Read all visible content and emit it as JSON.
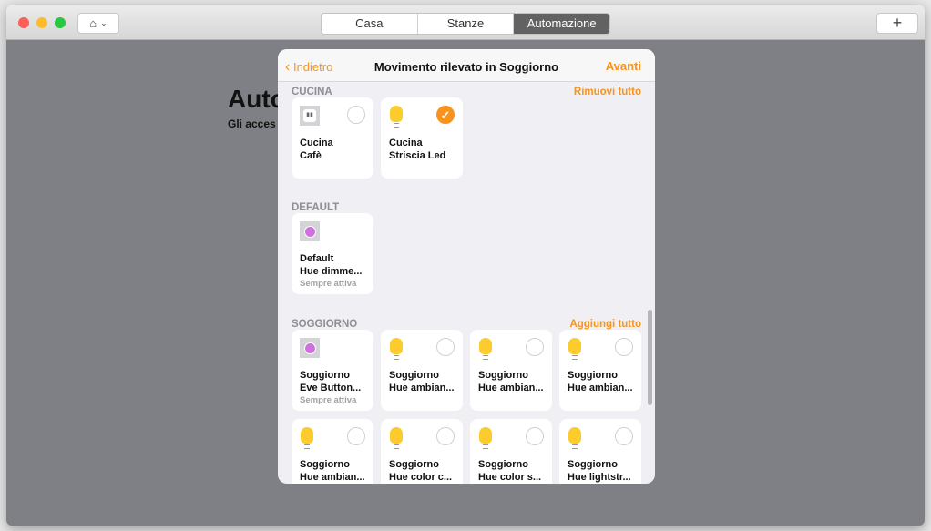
{
  "window": {
    "tabs": [
      "Casa",
      "Stanze",
      "Automazione"
    ],
    "active_tab": "Automazione",
    "add_label": "+",
    "home_icon": "home-icon"
  },
  "behind": {
    "title": "Auto",
    "subtitle": "Gli acces"
  },
  "modal": {
    "back_label": "Indietro",
    "title": "Movimento rilevato in Soggiorno",
    "next_label": "Avanti",
    "accent": "#f7931e",
    "sections": [
      {
        "label": "CUCINA",
        "action": "Rimuovi tutto",
        "tiles": [
          {
            "room": "Cucina",
            "name": "Cafè",
            "icon": "outlet-icon",
            "selected": false
          },
          {
            "room": "Cucina",
            "name": "Striscia Led",
            "icon": "bulb-icon",
            "selected": true
          }
        ]
      },
      {
        "label": "DEFAULT",
        "action": "",
        "tiles": [
          {
            "room": "Default",
            "name": "Hue dimme...",
            "status": "Sempre attiva",
            "icon": "button-icon"
          }
        ]
      },
      {
        "label": "SOGGIORNO",
        "action": "Aggiungi tutto",
        "tiles": [
          {
            "room": "Soggiorno",
            "name": "Eve Button...",
            "status": "Sempre attiva",
            "icon": "button-icon"
          },
          {
            "room": "Soggiorno",
            "name": "Hue ambian...",
            "icon": "bulb-icon",
            "selected": false
          },
          {
            "room": "Soggiorno",
            "name": "Hue ambian...",
            "icon": "bulb-icon",
            "selected": false
          },
          {
            "room": "Soggiorno",
            "name": "Hue ambian...",
            "icon": "bulb-icon",
            "selected": false
          },
          {
            "room": "Soggiorno",
            "name": "Hue ambian...",
            "icon": "bulb-icon",
            "selected": false
          },
          {
            "room": "Soggiorno",
            "name": "Hue color c...",
            "icon": "bulb-icon",
            "selected": false
          },
          {
            "room": "Soggiorno",
            "name": "Hue color s...",
            "icon": "bulb-icon",
            "selected": false
          },
          {
            "room": "Soggiorno",
            "name": "Hue lightstr...",
            "icon": "bulb-icon",
            "selected": false
          }
        ]
      }
    ]
  }
}
